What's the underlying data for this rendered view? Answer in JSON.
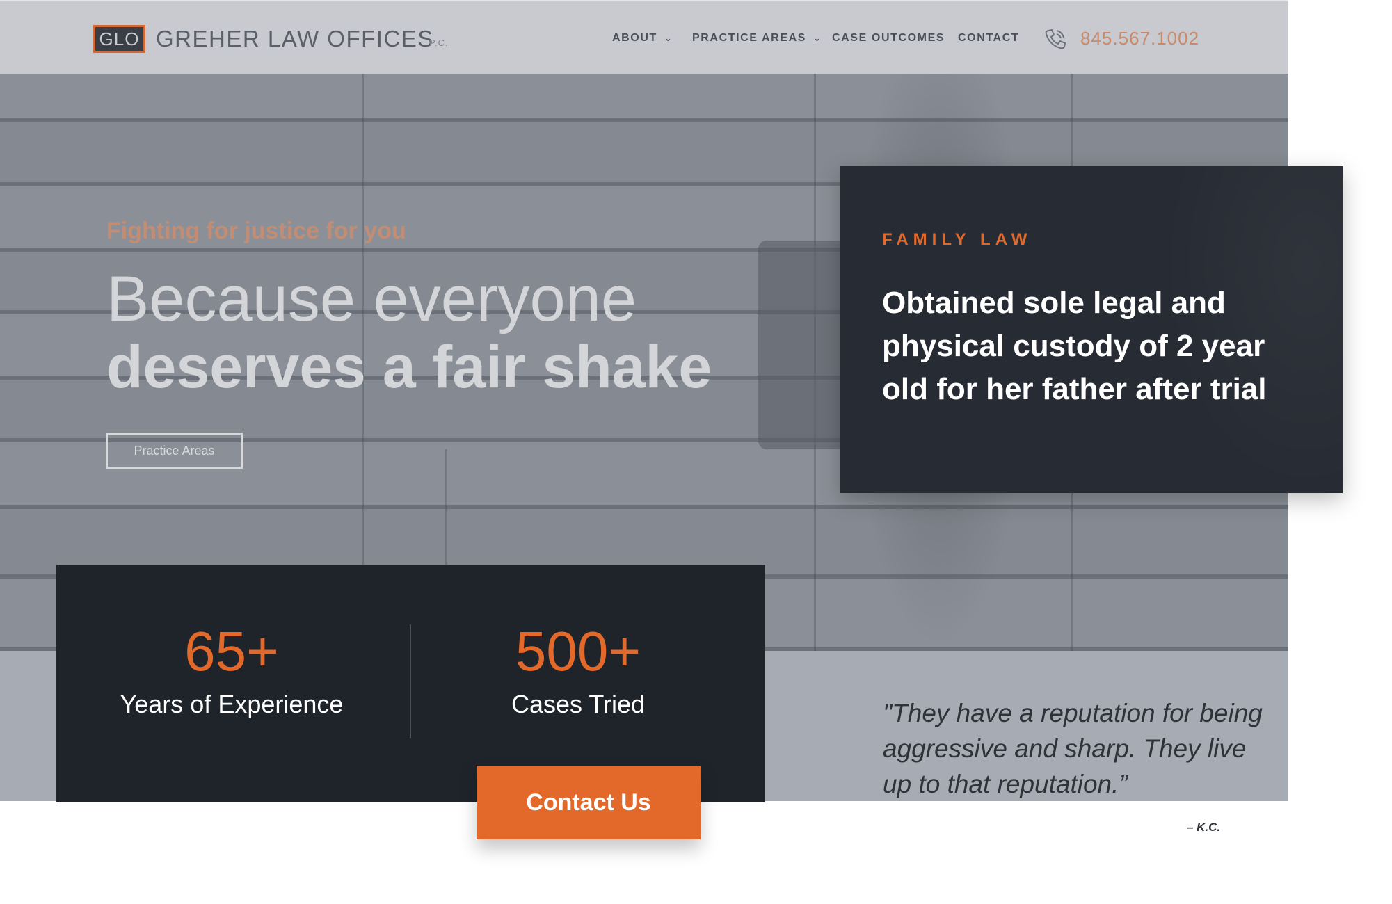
{
  "header": {
    "logo_mark": "GLO",
    "logo_name": "GREHER LAW OFFICES",
    "logo_suffix": "P.C.",
    "nav": [
      {
        "label": "ABOUT",
        "has_dropdown": true
      },
      {
        "label": "PRACTICE AREAS",
        "has_dropdown": true
      },
      {
        "label": "CASE OUTCOMES",
        "has_dropdown": false
      },
      {
        "label": "CONTACT",
        "has_dropdown": false
      }
    ],
    "phone_icon": "phone-icon",
    "phone_number": "845.567.1002"
  },
  "hero": {
    "tagline": "Fighting for justice for you",
    "headline_light": "Because everyone",
    "headline_bold": "deserves a fair shake",
    "practice_button": "Practice Areas"
  },
  "case_card": {
    "category": "FAMILY LAW",
    "text": "Obtained sole legal and physical custody of 2 year old for her father after trial"
  },
  "stats": [
    {
      "value": "65+",
      "label": "Years of Experience"
    },
    {
      "value": "500+",
      "label": "Cases Tried"
    }
  ],
  "contact_button": "Contact Us",
  "testimonial": {
    "quote": "\"They have a reputation for being aggressive and sharp. They live up to that reputation.”",
    "author": "– K.C."
  },
  "colors": {
    "accent": "#e3692a",
    "dark_card": "#272c34",
    "stats_card": "#1f242b",
    "header_bg": "#c8cacf"
  }
}
